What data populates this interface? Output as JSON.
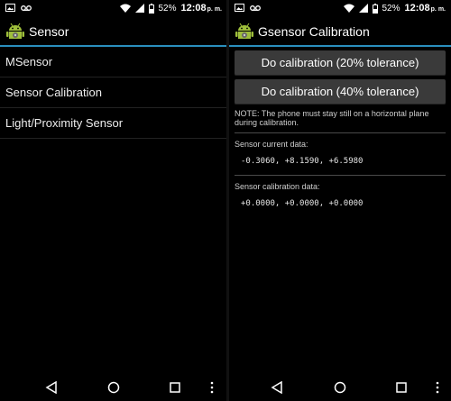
{
  "status": {
    "battery": "52%",
    "time": "12:08",
    "ampm": "p. m."
  },
  "left": {
    "title": "Sensor",
    "items": [
      "MSensor",
      "Sensor Calibration",
      "Light/Proximity Sensor"
    ]
  },
  "right": {
    "title": "Gsensor Calibration",
    "btn20": "Do calibration (20% tolerance)",
    "btn40": "Do calibration (40% tolerance)",
    "note": "NOTE: The phone must stay still on a horizontal plane during calibration.",
    "current_label": "Sensor current data:",
    "current_value": "-0.3060, +8.1590, +6.5980",
    "calib_label": "Sensor calibration data:",
    "calib_value": "+0.0000, +0.0000, +0.0000"
  },
  "colors": {
    "accent": "#2a8fbd",
    "android_green": "#9fbf3b"
  }
}
